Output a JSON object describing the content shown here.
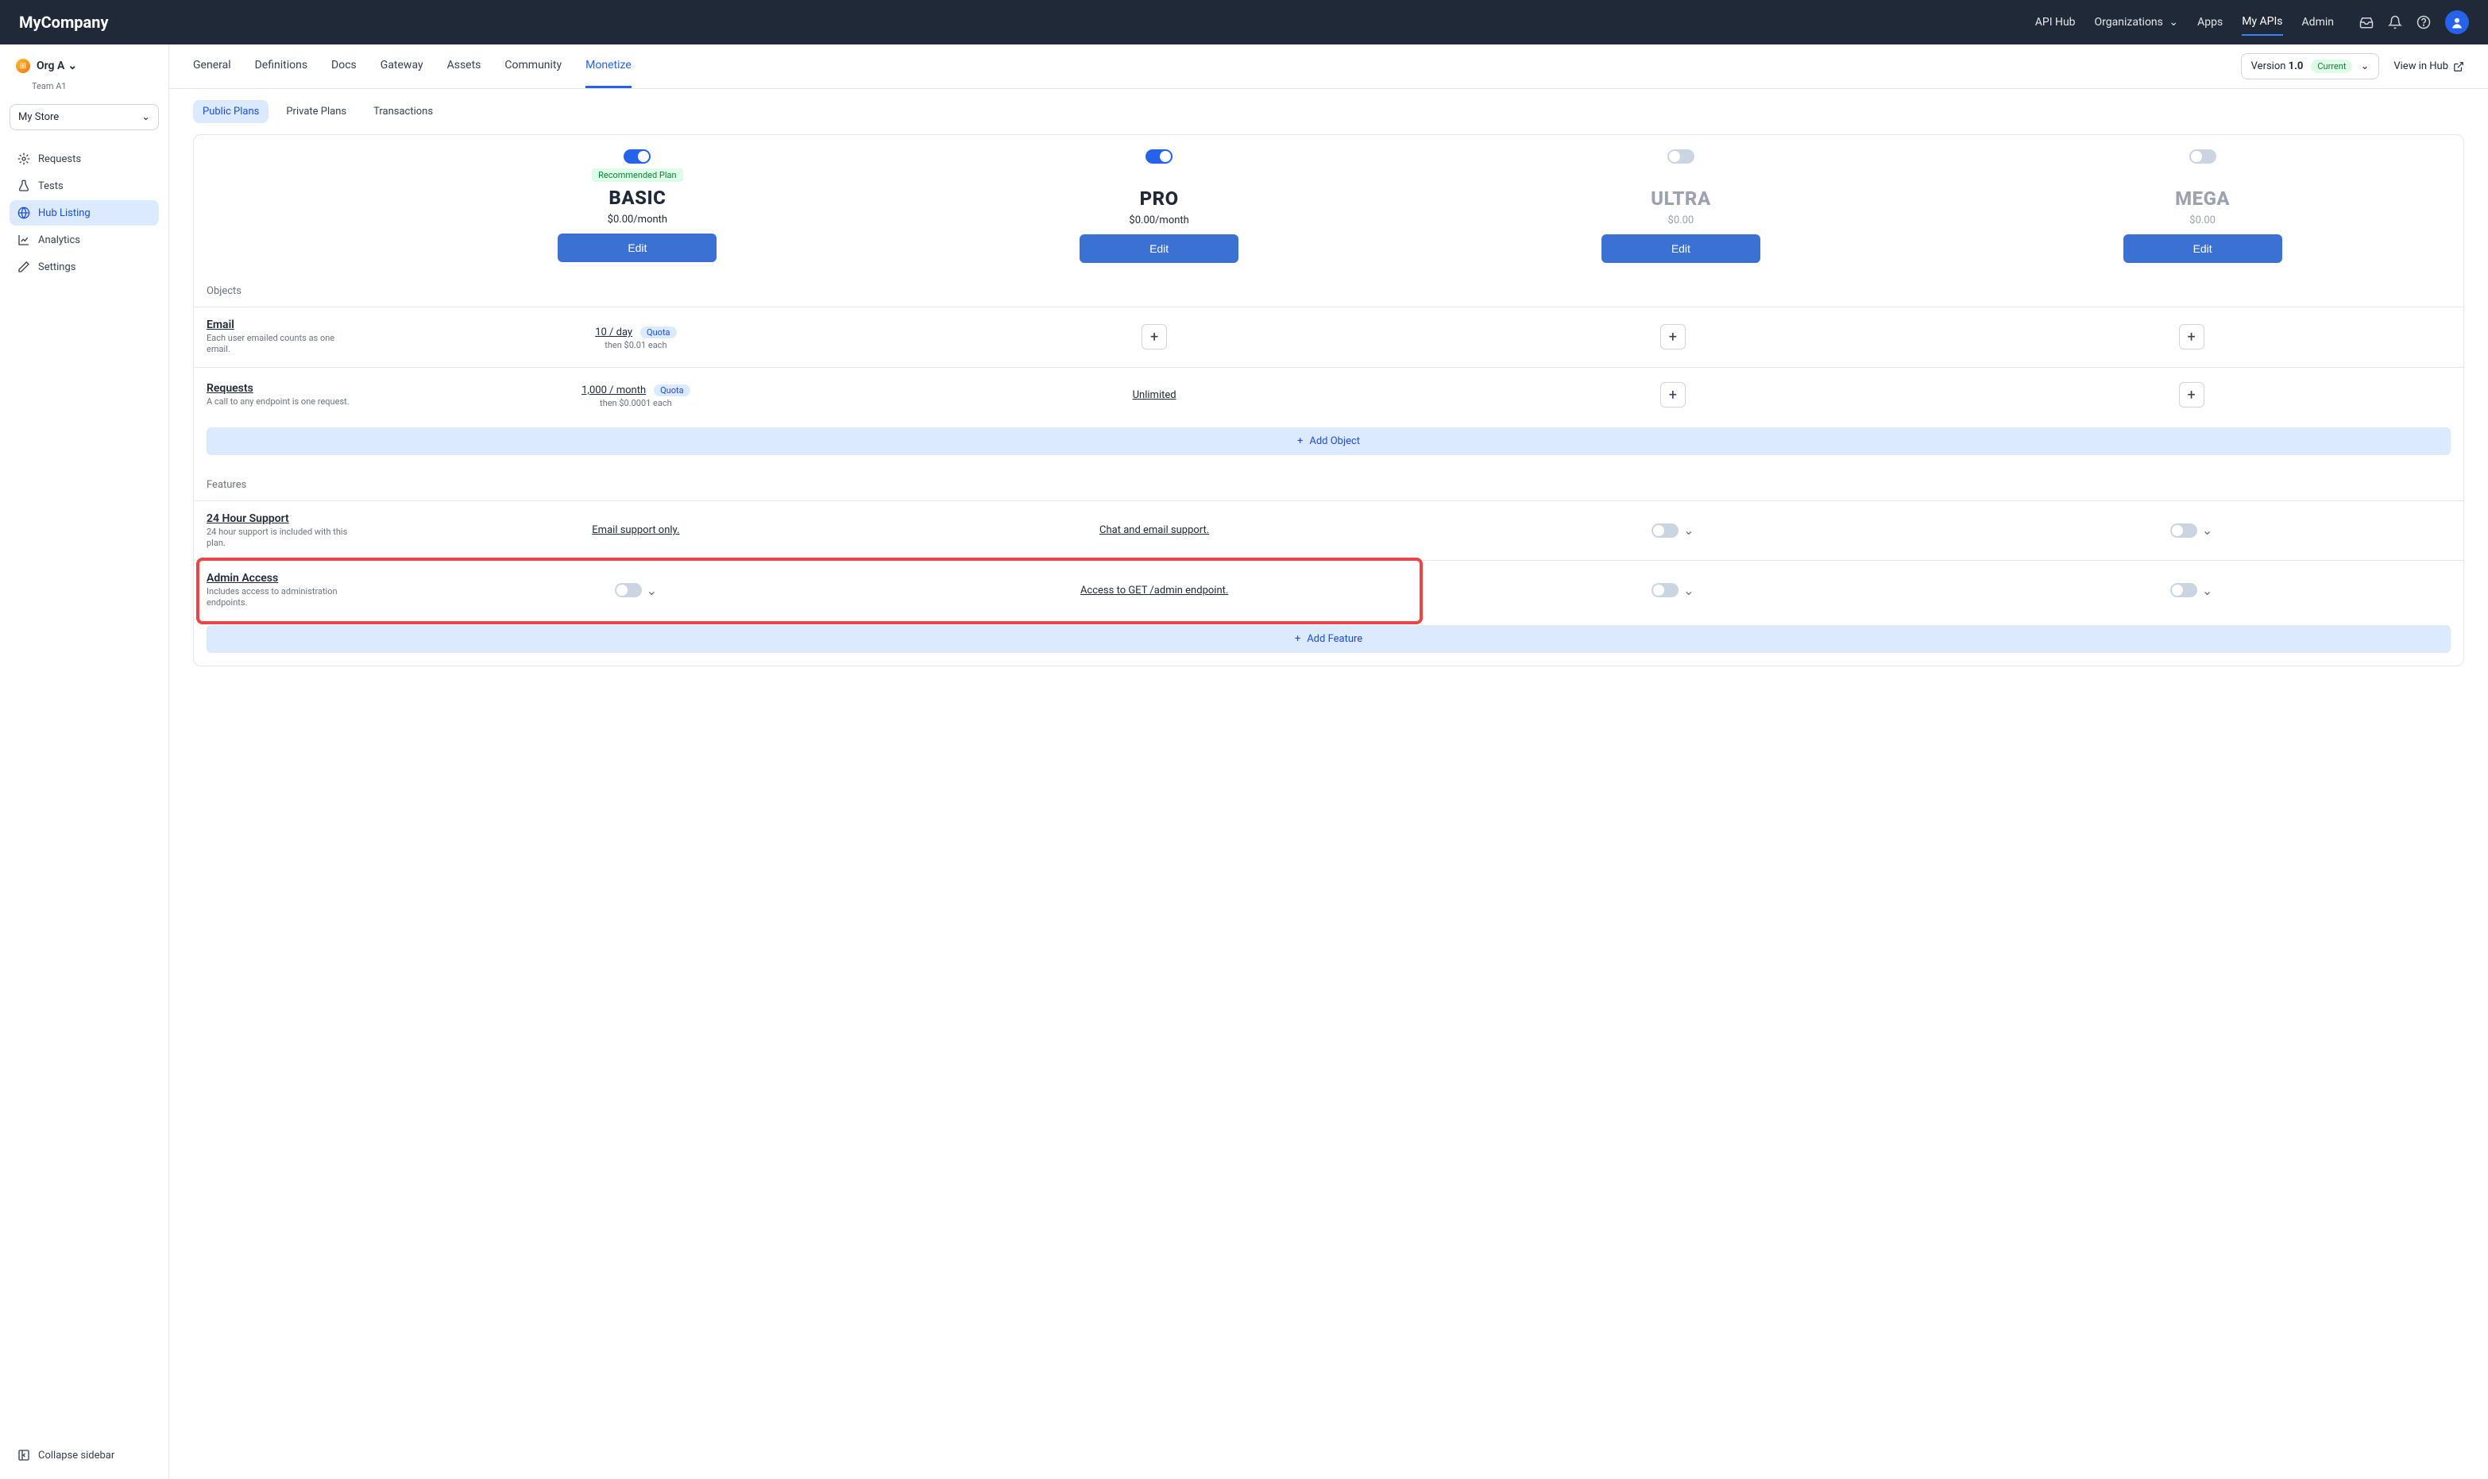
{
  "brand": "MyCompany",
  "topnav": {
    "items": [
      "API Hub",
      "Organizations",
      "Apps",
      "My APIs",
      "Admin"
    ],
    "activeIndex": 3
  },
  "sidebar": {
    "org": {
      "name": "Org A",
      "team": "Team A1"
    },
    "project": "My Store",
    "menu": [
      {
        "label": "Requests"
      },
      {
        "label": "Tests"
      },
      {
        "label": "Hub Listing",
        "active": true
      },
      {
        "label": "Analytics"
      },
      {
        "label": "Settings"
      }
    ],
    "collapse": "Collapse sidebar"
  },
  "mainTabs": {
    "items": [
      "General",
      "Definitions",
      "Docs",
      "Gateway",
      "Assets",
      "Community",
      "Monetize"
    ],
    "activeIndex": 6,
    "versionLabel": "Version",
    "versionValue": "1.0",
    "currentBadge": "Current",
    "viewInHub": "View in Hub"
  },
  "subTabs": {
    "items": [
      "Public Plans",
      "Private Plans",
      "Transactions"
    ],
    "activeIndex": 0
  },
  "plans": [
    {
      "enabled": true,
      "recommended": true,
      "name": "BASIC",
      "price": "$0.00/month",
      "edit": "Edit"
    },
    {
      "enabled": true,
      "recommended": false,
      "name": "PRO",
      "price": "$0.00/month",
      "edit": "Edit"
    },
    {
      "enabled": false,
      "recommended": false,
      "name": "ULTRA",
      "price": "$0.00",
      "edit": "Edit"
    },
    {
      "enabled": false,
      "recommended": false,
      "name": "MEGA",
      "price": "$0.00",
      "edit": "Edit"
    }
  ],
  "objects": {
    "label": "Objects",
    "rows": [
      {
        "title": "Email",
        "desc": "Each user emailed counts as one email.",
        "cells": [
          {
            "type": "quota",
            "main": "10 / day",
            "badge": "Quota",
            "sub": "then $0.01 each"
          },
          {
            "type": "plus"
          },
          {
            "type": "plus"
          },
          {
            "type": "plus"
          }
        ]
      },
      {
        "title": "Requests",
        "desc": "A call to any endpoint is one request.",
        "cells": [
          {
            "type": "quota",
            "main": "1,000 / month",
            "badge": "Quota",
            "sub": "then $0.0001 each"
          },
          {
            "type": "text",
            "main": "Unlimited"
          },
          {
            "type": "plus"
          },
          {
            "type": "plus"
          }
        ]
      }
    ],
    "addLabel": "Add Object"
  },
  "features": {
    "label": "Features",
    "rows": [
      {
        "title": "24 Hour Support",
        "desc": "24 hour support is included with this plan.",
        "cells": [
          {
            "type": "text",
            "main": "Email support only."
          },
          {
            "type": "text",
            "main": "Chat and email support."
          },
          {
            "type": "toggle",
            "on": false
          },
          {
            "type": "toggle",
            "on": false
          }
        ]
      },
      {
        "title": "Admin Access",
        "desc": "Includes access to administration endpoints.",
        "highlight": true,
        "cells": [
          {
            "type": "toggle",
            "on": false
          },
          {
            "type": "text",
            "main": "Access to GET /admin endpoint."
          },
          {
            "type": "toggle",
            "on": false
          },
          {
            "type": "toggle",
            "on": false
          }
        ]
      }
    ],
    "addLabel": "Add Feature"
  },
  "recommendedBadge": "Recommended Plan"
}
